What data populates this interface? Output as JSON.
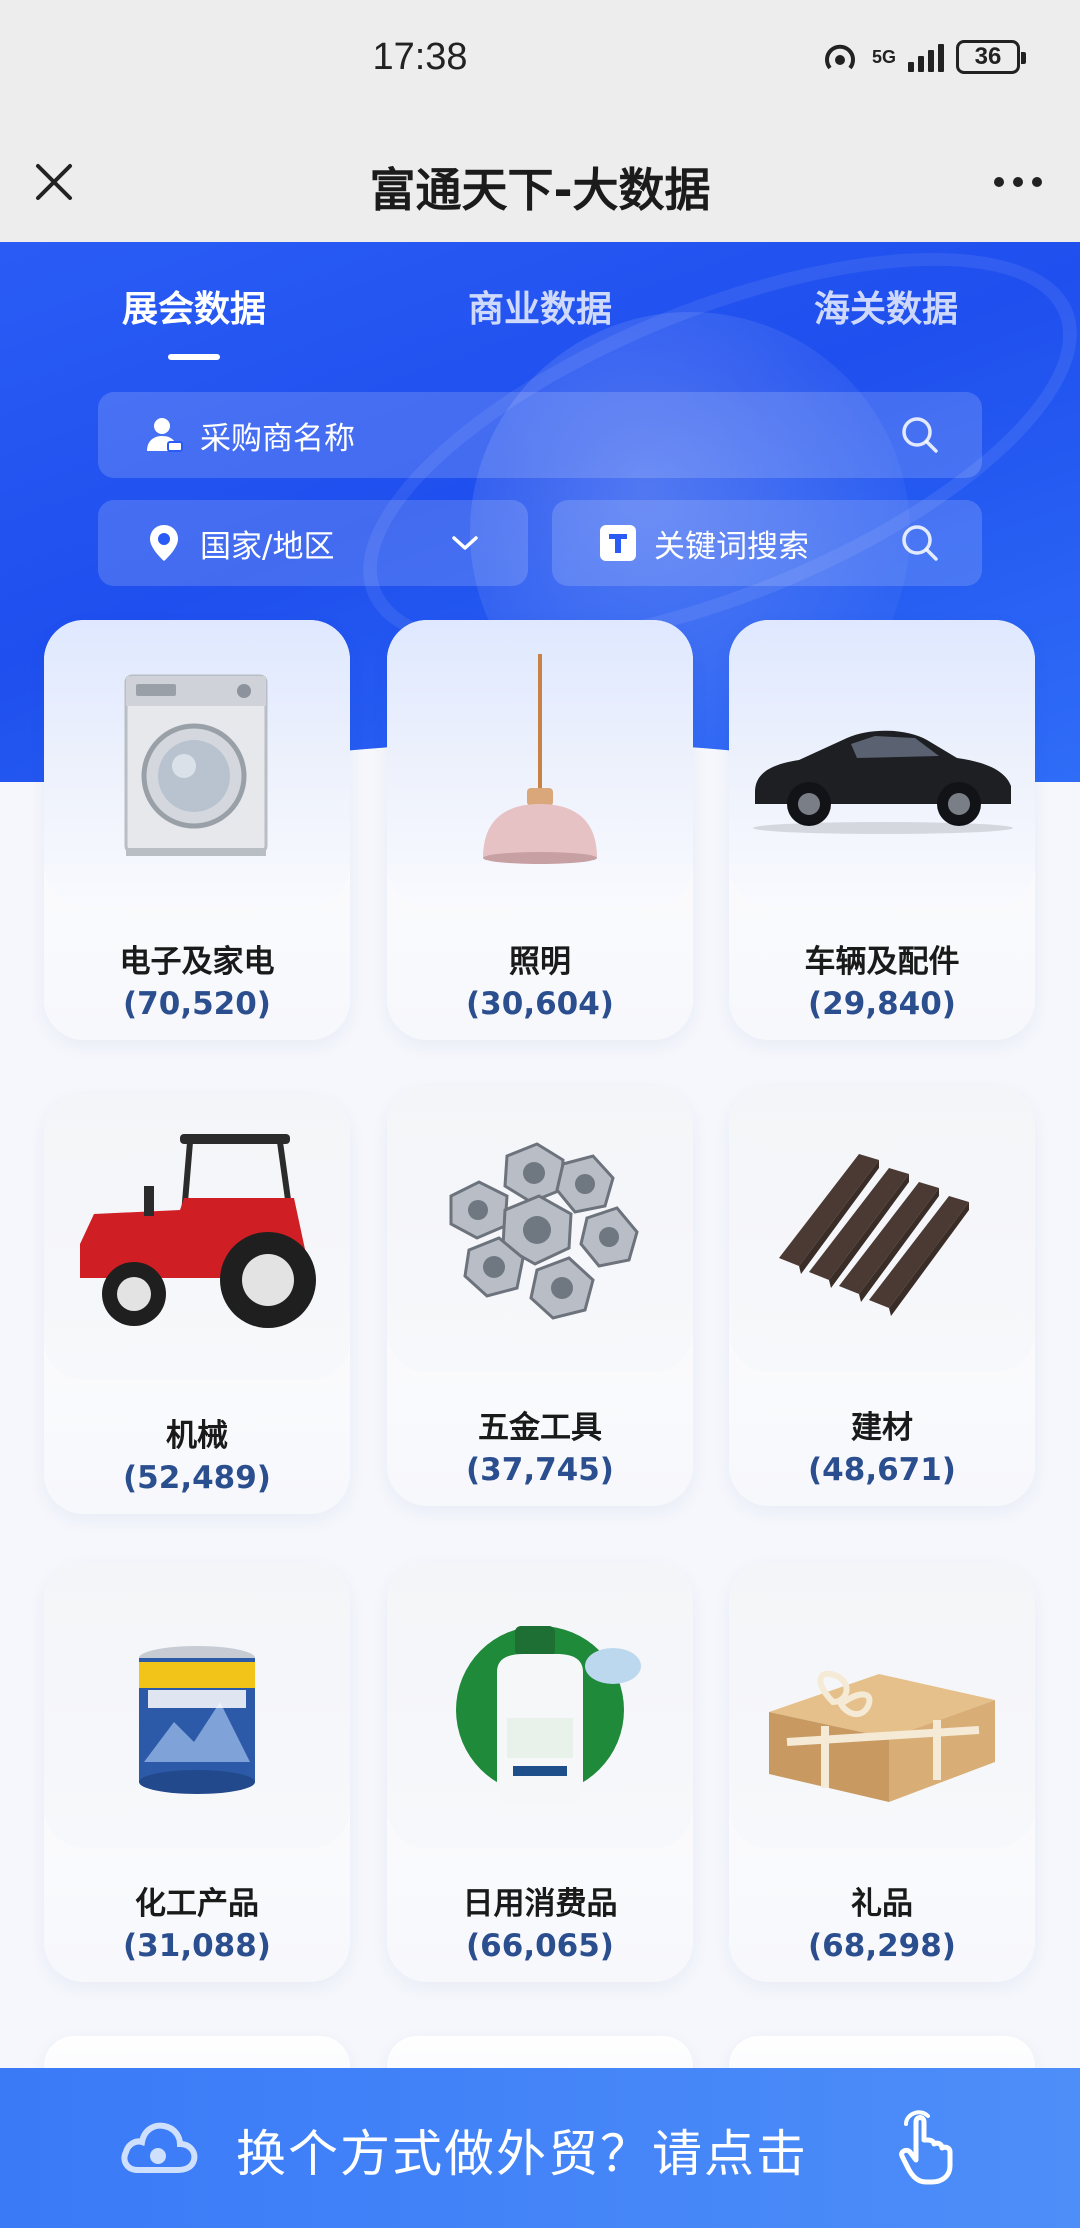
{
  "status_bar": {
    "time": "17:38",
    "network": "5G",
    "battery": "36"
  },
  "nav": {
    "title": "富通天下-大数据"
  },
  "tabs": [
    {
      "label": "展会数据",
      "active": true
    },
    {
      "label": "商业数据",
      "active": false
    },
    {
      "label": "海关数据",
      "active": false
    }
  ],
  "filters": {
    "buyer_name": "采购商名称",
    "country_region": "国家/地区",
    "keyword_search": "关键词搜索"
  },
  "categories": [
    {
      "name": "电子及家电",
      "count": "(70,520)",
      "icon": "washing-machine"
    },
    {
      "name": "照明",
      "count": "(30,604)",
      "icon": "pendant-lamp"
    },
    {
      "name": "车辆及配件",
      "count": "(29,840)",
      "icon": "sports-car"
    },
    {
      "name": "机械",
      "count": "(52,489)",
      "icon": "tractor"
    },
    {
      "name": "五金工具",
      "count": "(37,745)",
      "icon": "hex-nuts"
    },
    {
      "name": "建材",
      "count": "(48,671)",
      "icon": "wall-panel"
    },
    {
      "name": "化工产品",
      "count": "(31,088)",
      "icon": "paint-bucket"
    },
    {
      "name": "日用消费品",
      "count": "(66,065)",
      "icon": "detergent-bottle"
    },
    {
      "name": "礼品",
      "count": "(68,298)",
      "icon": "gift-box"
    }
  ],
  "banner": {
    "text": "换个方式做外贸？请点击"
  },
  "colors": {
    "accent_blue": "#1f4fee",
    "count_text": "#2a4e8e",
    "banner": "#3a7af7"
  }
}
